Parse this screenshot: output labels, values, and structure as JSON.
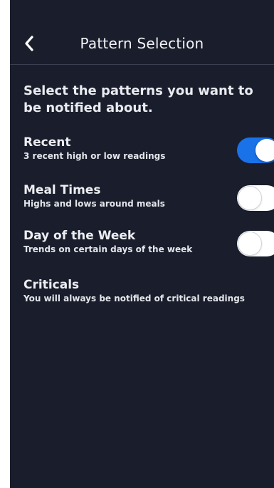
{
  "header": {
    "title": "Pattern Selection",
    "back_icon": "chevron-left-icon"
  },
  "intro_text": "Select the patterns you want to be notified about.",
  "patterns": [
    {
      "title": "Recent",
      "subtitle": "3 recent high or low readings",
      "enabled": true
    },
    {
      "title": "Meal Times",
      "subtitle": "Highs and lows around meals",
      "enabled": false
    },
    {
      "title": "Day of the Week",
      "subtitle": "Trends on certain days of the week",
      "enabled": false
    }
  ],
  "criticals": {
    "title": "Criticals",
    "subtitle": "You will always be notified of critical readings"
  },
  "colors": {
    "background": "#1a1e2c",
    "toggle_on": "#1a72e8",
    "toggle_off": "#ffffff"
  }
}
